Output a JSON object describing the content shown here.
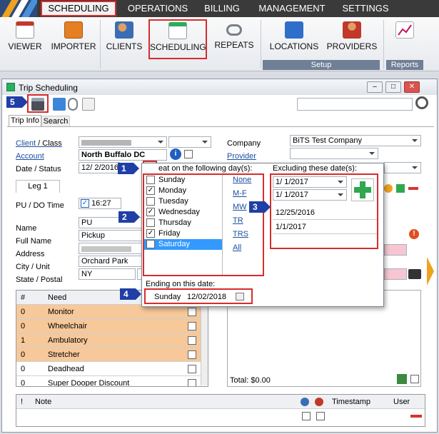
{
  "menu": {
    "tabs": [
      "SCHEDULING",
      "OPERATIONS",
      "BILLING",
      "MANAGEMENT",
      "SETTINGS"
    ]
  },
  "ribbon": {
    "buttons": [
      "VIEWER",
      "IMPORTER",
      "CLIENTS",
      "SCHEDULING",
      "REPEATS",
      "LOCATIONS",
      "PROVIDERS",
      "REPORTS"
    ],
    "groups": {
      "setup": "Setup",
      "reports": "Reports"
    }
  },
  "window": {
    "title": "Trip Scheduling"
  },
  "tabs": [
    "Trip Info",
    "Search"
  ],
  "form": {
    "client_label": "Client",
    "client_suffix": " / Class",
    "account_label": "Account",
    "account_value": "North Buffalo DC",
    "date_label": "Date",
    "date_suffix": " / Status",
    "date_value": "12/ 2/2016",
    "leg": "Leg 1",
    "pudo_label": "PU / DO Time",
    "time_value": "16:27",
    "name_label": "Name",
    "name_value": "PU",
    "fullname_label": "Full Name",
    "fullname_value": "Pickup",
    "address_label": "Address",
    "city_label": "City",
    "city_suffix": " / Unit",
    "city_value": "Orchard Park",
    "state_label": "State",
    "state_suffix": " / Postal",
    "state_value": "NY",
    "company_label": "Company",
    "company_value": "BiTS Test Company",
    "provider_label": "Provider",
    "total_label": "Total: $0.00"
  },
  "needs": {
    "headers": [
      "#",
      "Need"
    ],
    "rows": [
      {
        "n": "0",
        "need": "Monitor"
      },
      {
        "n": "0",
        "need": "Wheelchair"
      },
      {
        "n": "1",
        "need": "Ambulatory"
      },
      {
        "n": "0",
        "need": "Stretcher"
      },
      {
        "n": "0",
        "need": "Deadhead"
      },
      {
        "n": "0",
        "need": "Super Dooper Discount"
      }
    ]
  },
  "notes": {
    "headers": [
      "!",
      "Note",
      "Timestamp",
      "User"
    ]
  },
  "repeat": {
    "title": "eat on the following day(s):",
    "days": [
      {
        "d": "Sunday",
        "c": false
      },
      {
        "d": "Monday",
        "c": true
      },
      {
        "d": "Tuesday",
        "c": false
      },
      {
        "d": "Wednesday",
        "c": true
      },
      {
        "d": "Thursday",
        "c": false
      },
      {
        "d": "Friday",
        "c": true
      },
      {
        "d": "Saturday",
        "c": false
      }
    ],
    "links": [
      "None",
      "M-F",
      "MW",
      "TR",
      "TRS",
      "All"
    ],
    "ending_label": "Ending on this date:",
    "ending_day": "Sunday",
    "ending_date": "12/02/2018",
    "excluding_label": "Excluding these date(s):",
    "date_pickers": [
      "1/ 1/2017",
      "1/ 1/2017"
    ],
    "excluded": [
      "12/25/2016",
      "1/1/2017"
    ]
  },
  "callouts": [
    "1",
    "2",
    "3",
    "4",
    "5"
  ]
}
